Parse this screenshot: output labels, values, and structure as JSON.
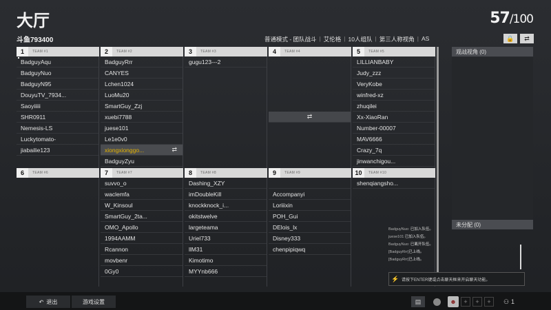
{
  "header": {
    "title": "大厅",
    "room_name": "斗鱼793400",
    "count": "57",
    "max": "/100"
  },
  "mode": {
    "items": [
      "普通模式 - 团队战斗",
      "艾伦格",
      "10人组队",
      "第三人称视角",
      "AS"
    ]
  },
  "icons": {
    "lock": "lock-icon",
    "swap": "swap-icon"
  },
  "teams": [
    {
      "num": "1",
      "label": "TEAM #1",
      "players": [
        "BadguyAqu",
        "BadguyNuo",
        "BadguyN95",
        "DouyuTV_7934...",
        "Saoyiiiii",
        "SHR0911",
        "Nemesis-LS",
        "Luckytomato-",
        "jiabailie123"
      ]
    },
    {
      "num": "2",
      "label": "TEAM #2",
      "players": [
        "BadguyRrr",
        "CANYES",
        "Lchen1024",
        "LuoMu20",
        "SmartGuy_Zzj",
        "xuebi7788",
        "juese101",
        "Le1e0v0",
        "xiongxionggo...",
        "BadguyZyu"
      ]
    },
    {
      "num": "3",
      "label": "TEAM #3",
      "players": [
        "gugu123---2"
      ]
    },
    {
      "num": "4",
      "label": "TEAM #4",
      "players": []
    },
    {
      "num": "5",
      "label": "TEAM #5",
      "players": [
        "LILLIANBABY",
        "Judy_zzz",
        "VeryKobe",
        "winfred-xz",
        "zhuqilei",
        "Xx-XiaoRan",
        "Number-00007",
        "MAV6666",
        "Crazy_7q",
        "jinwanchigou..."
      ]
    },
    {
      "num": "6",
      "label": "TEAM #6",
      "players": []
    },
    {
      "num": "7",
      "label": "TEAM #7",
      "players": [
        "suvvo_o",
        "waclemfa",
        "W_Kinsoul",
        "SmartGuy_2ta...",
        "OMO_Apollo",
        "1994AAMM",
        "Rcannon",
        "movbenr",
        "0Gy0"
      ]
    },
    {
      "num": "8",
      "label": "TEAM #8",
      "players": [
        "Dashing_XZY",
        "imDoubleKill",
        "knockknock_i...",
        "okitstwelve",
        "largeteama",
        "Uriel733",
        "llM31",
        "Kimotimo",
        "MYYnb666"
      ]
    },
    {
      "num": "9",
      "label": "TEAM #9",
      "players": [
        "",
        "Accompanyi",
        "Loriiixin",
        "POH_Gui",
        "DElois_lx",
        "Disney333",
        "chenpipiqwq"
      ]
    },
    {
      "num": "10",
      "label": "TEAM #10",
      "players": [
        "shenqiangsho..."
      ]
    }
  ],
  "side": {
    "spectators": "观战视角 (0)",
    "unassigned": "未分配 (0)"
  },
  "chat": {
    "lines": [
      {
        "who": "BadguyNuo:",
        "msg": "已加入队伍。"
      },
      {
        "who": "juese101",
        "msg": "已加入队伍。"
      },
      {
        "who": "BadguyNuo:",
        "msg": "已离开队伍。"
      },
      {
        "who": "[BadguyRrr]",
        "msg": "已上线。"
      },
      {
        "who": "[BadguyRrr]",
        "msg": "已上线。"
      }
    ],
    "placeholder": "请按下ENTER键或点击聊天框来开启聊天功能。"
  },
  "bottom": {
    "back": "退出",
    "settings": "游戏设置",
    "party_count": "1"
  }
}
